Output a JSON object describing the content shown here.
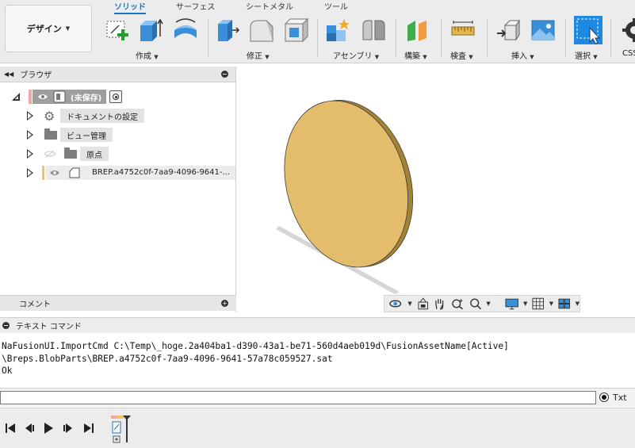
{
  "toolbar": {
    "workspace": "デザイン",
    "tabs": [
      "ソリッド",
      "サーフェス",
      "シートメタル",
      "ツール"
    ],
    "groups": [
      "作成",
      "修正",
      "アセンブリ",
      "構築",
      "検査",
      "挿入",
      "選択"
    ],
    "clipped_label": "CSS"
  },
  "browser": {
    "title": "ブラウザ",
    "root_label": "(未保存)",
    "items": [
      "ドキュメントの設定",
      "ビュー管理",
      "原点",
      "BREP.a4752c0f-7aa9-4096-9641-..."
    ]
  },
  "comments": {
    "title": "コメント"
  },
  "textcommand": {
    "title": "テキスト コマンド",
    "output": "NaFusionUI.ImportCmd C:\\Temp\\_hoge.2a404ba1-d390-43a1-be71-560d4aeb019d\\FusionAssetName[Active]\n\\Breps.BlobParts\\BREP.a4752c0f-7aa9-4096-9641-57a78c059527.sat\nOk",
    "mode_label": "Txt"
  },
  "colors": {
    "accent": "#1a73c8",
    "body_fill": "#e3bd6c",
    "selection_blue": "#1e88e5"
  },
  "icons": {
    "toolbar": [
      "sketch-icon",
      "extrude-icon",
      "revolve-icon",
      "press-pull-icon",
      "fillet-icon",
      "shell-icon",
      "new-component-icon",
      "joint-icon",
      "plane-icon",
      "measure-icon",
      "insert-derive-icon",
      "insert-image-icon",
      "select-icon",
      "scripts-icon"
    ],
    "navbar": [
      "orbit-icon",
      "look-at-icon",
      "pan-icon",
      "zoom-icon",
      "fit-icon",
      "display-icon",
      "grid-icon",
      "viewports-icon"
    ],
    "timeline": [
      "first-icon",
      "previous-icon",
      "play-icon",
      "next-icon",
      "last-icon"
    ]
  }
}
